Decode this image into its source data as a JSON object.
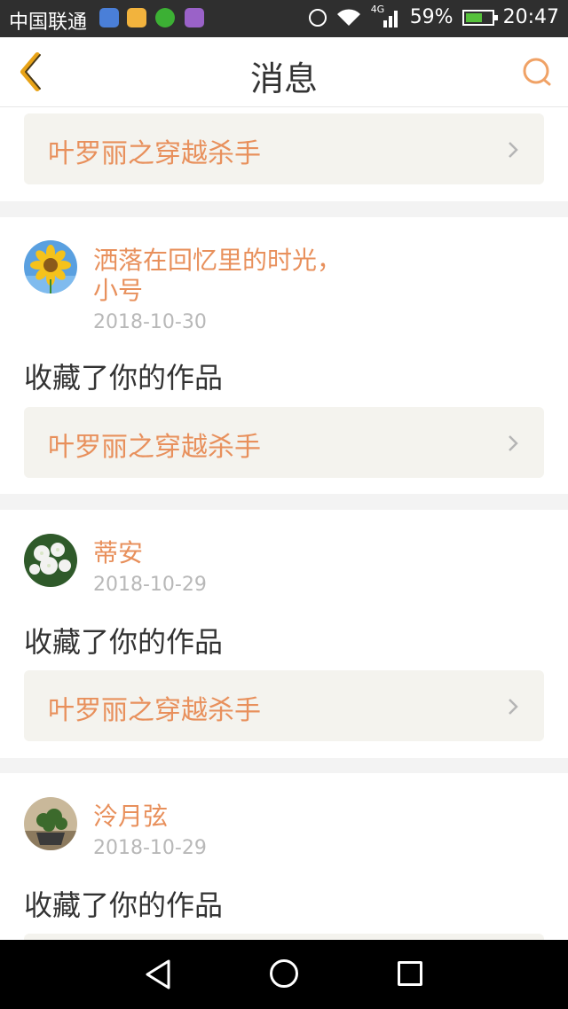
{
  "status_bar": {
    "carrier": "中国联通",
    "network": "4G",
    "battery": "59%",
    "battery_level": 0.59,
    "time": "20:47"
  },
  "header": {
    "title": "消息",
    "back_icon": "chevron-left-icon",
    "search_icon": "search-icon"
  },
  "colors": {
    "accent": "#e8905c",
    "back_icon": "#e8a317",
    "link_bg": "#f4f3ee",
    "date": "#b8b8b8"
  },
  "messages": [
    {
      "work_title": "叶罗丽之穿越杀手"
    },
    {
      "user_line1": "洒落在回忆里的时光，",
      "user_line2": "小号",
      "date": "2018-10-30",
      "action": "收藏了你的作品",
      "work_title": "叶罗丽之穿越杀手"
    },
    {
      "user_line1": "蒂安",
      "date": "2018-10-29",
      "action": "收藏了你的作品",
      "work_title": "叶罗丽之穿越杀手"
    },
    {
      "user_line1": "泠月弦",
      "date": "2018-10-29",
      "action": "收藏了你的作品"
    }
  ]
}
